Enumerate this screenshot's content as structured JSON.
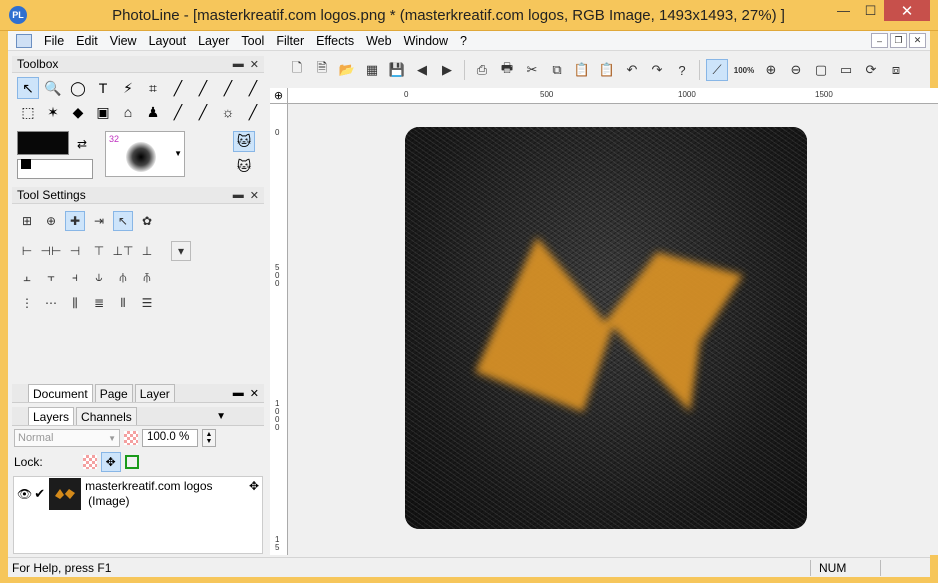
{
  "window": {
    "title": "PhotoLine - [masterkreatif.com logos.png * (masterkreatif.com logos, RGB Image, 1493x1493, 27%) ]",
    "app_icon_text": "PL",
    "minimize": "—",
    "maximize": "☐",
    "close": "✕"
  },
  "menu": {
    "items": [
      "File",
      "Edit",
      "View",
      "Layout",
      "Layer",
      "Tool",
      "Filter",
      "Effects",
      "Web",
      "Window",
      "?"
    ],
    "mdi": [
      "–",
      "❐",
      "✕"
    ]
  },
  "toolbox": {
    "title": "Toolbox",
    "pin": "▬",
    "close": "✕",
    "tools_row1": [
      "↖",
      "🔍",
      "◯",
      "T",
      "⚡",
      "⌗",
      "╱",
      "╱",
      "╱",
      "╱"
    ],
    "tools_row2": [
      "⬚",
      "✶",
      "◆",
      "▣",
      "⌂",
      "♟",
      "╱",
      "╱",
      "☼",
      "╱"
    ],
    "brush_size": "32"
  },
  "tool_settings": {
    "title": "Tool Settings",
    "pin": "▬",
    "close": "✕",
    "row1": [
      "⊞",
      "⊕",
      "✚",
      "⇥",
      "↖",
      "✿"
    ],
    "row2": [
      "⊢",
      "⊣⊢",
      "⊣",
      "⊤",
      "⊥⊤",
      "⊥",
      "▾"
    ],
    "row3": [
      "⫠",
      "⫟",
      "⫞",
      "⫝",
      "⫛",
      "⫚"
    ],
    "row4": [
      "⋮",
      "⋯",
      "⫼",
      "≣",
      "⫴",
      "☰"
    ]
  },
  "layers_panel": {
    "tabs_top": [
      "Document",
      "Page",
      "Layer"
    ],
    "tabs": [
      "Layers",
      "Channels"
    ],
    "blend_mode": "Normal",
    "opacity": "100.0 %",
    "lock_label": "Lock:",
    "layer": {
      "name": "masterkreatif.com logos",
      "type": "(Image)"
    },
    "pin": "▬",
    "close": "✕",
    "menu": "▼"
  },
  "main_toolbar": {
    "zoom_label": "100%"
  },
  "ruler": {
    "h_labels": [
      "0",
      "500",
      "1000",
      "1500"
    ],
    "v_labels": [
      "0",
      "5\n0\n0",
      "1\n0\n0\n0",
      "1\n5"
    ]
  },
  "status": {
    "help": "For Help, press F1",
    "num": "NUM"
  },
  "colors": {
    "title_bar": "#f6c65b",
    "logo_fill": "#d48a1a",
    "image_bg": "#1f1f1f"
  }
}
